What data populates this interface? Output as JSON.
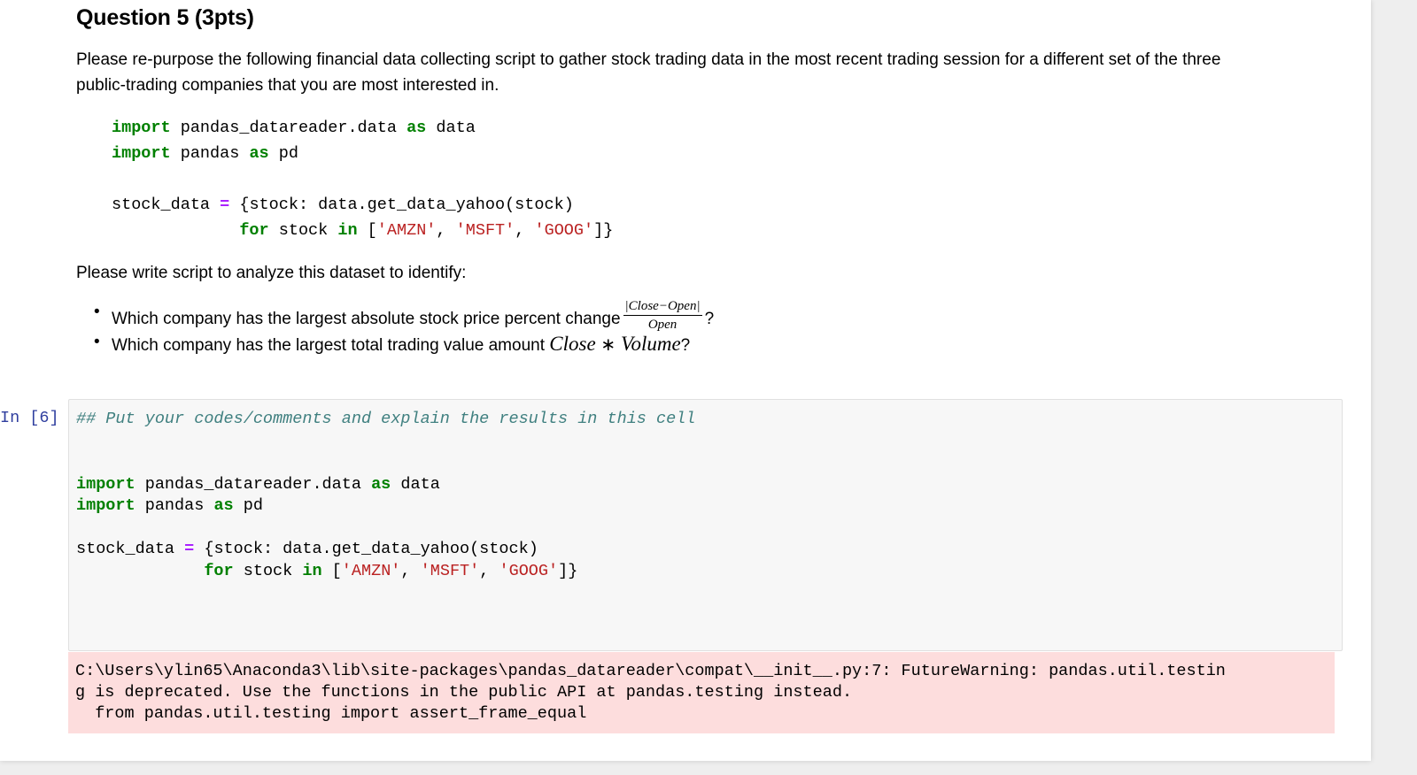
{
  "question": {
    "title": "Question 5 (3pts)",
    "intro_line1": "Please re-purpose the following financial data collecting script to gather stock trading data in the most recent trading session for a different set of the three",
    "intro_line2": "public-trading companies that you are most interested in.",
    "analyze_prompt": "Please write script to analyze this dataset to identify:",
    "bullets": [
      {
        "text": "Which company has the largest absolute stock price percent change",
        "frac_num": "|Close−Open|",
        "frac_den": "Open",
        "suffix": "?"
      },
      {
        "text": "Which company has the largest total trading value amount",
        "math_a": "Close",
        "math_op": "∗",
        "math_b": "Volume",
        "suffix": "?"
      }
    ]
  },
  "example_code": {
    "l1_kw": "import",
    "l1_mod": " pandas_datareader.data ",
    "l1_as": "as",
    "l1_alias": " data",
    "l2_kw": "import",
    "l2_mod": " pandas ",
    "l2_as": "as",
    "l2_alias": " pd",
    "l3_var": "stock_data ",
    "l3_op": "=",
    "l3_rest": " {stock: data.get_data_yahoo(stock)",
    "l4_indent": "             ",
    "l4_for": "for",
    "l4_mid": " stock ",
    "l4_in": "in",
    "l4_open": " [",
    "s1": "'AMZN'",
    "sep1": ", ",
    "s2": "'MSFT'",
    "sep2": ", ",
    "s3": "'GOOG'",
    "l4_close": "]}"
  },
  "cell": {
    "prompt": "In [6]:",
    "comment": "## Put your codes/comments and explain the results in this cell",
    "l1_kw": "import",
    "l1_mod": " pandas_datareader.data ",
    "l1_as": "as",
    "l1_alias": " data",
    "l2_kw": "import",
    "l2_mod": " pandas ",
    "l2_as": "as",
    "l2_alias": " pd",
    "l3_var": "stock_data ",
    "l3_op": "=",
    "l3_rest": " {stock: data.get_data_yahoo(stock)",
    "l4_indent": "             ",
    "l4_for": "for",
    "l4_mid": " stock ",
    "l4_in": "in",
    "l4_open": " [",
    "s1": "'AMZN'",
    "sep1": ", ",
    "s2": "'MSFT'",
    "sep2": ", ",
    "s3": "'GOOG'",
    "l4_close": "]}"
  },
  "output": {
    "line1": "C:\\Users\\ylin65\\Anaconda3\\lib\\site-packages\\pandas_datareader\\compat\\__init__.py:7: FutureWarning: pandas.util.testin",
    "line2": "g is deprecated. Use the functions in the public API at pandas.testing instead.",
    "line3": "  from pandas.util.testing import assert_frame_equal"
  },
  "colors": {
    "keyword": "#008000",
    "string": "#ba2121",
    "operator": "#aa22ff",
    "comment": "#408080",
    "prompt": "#303f9f",
    "stderr_bg": "#fddddd"
  }
}
